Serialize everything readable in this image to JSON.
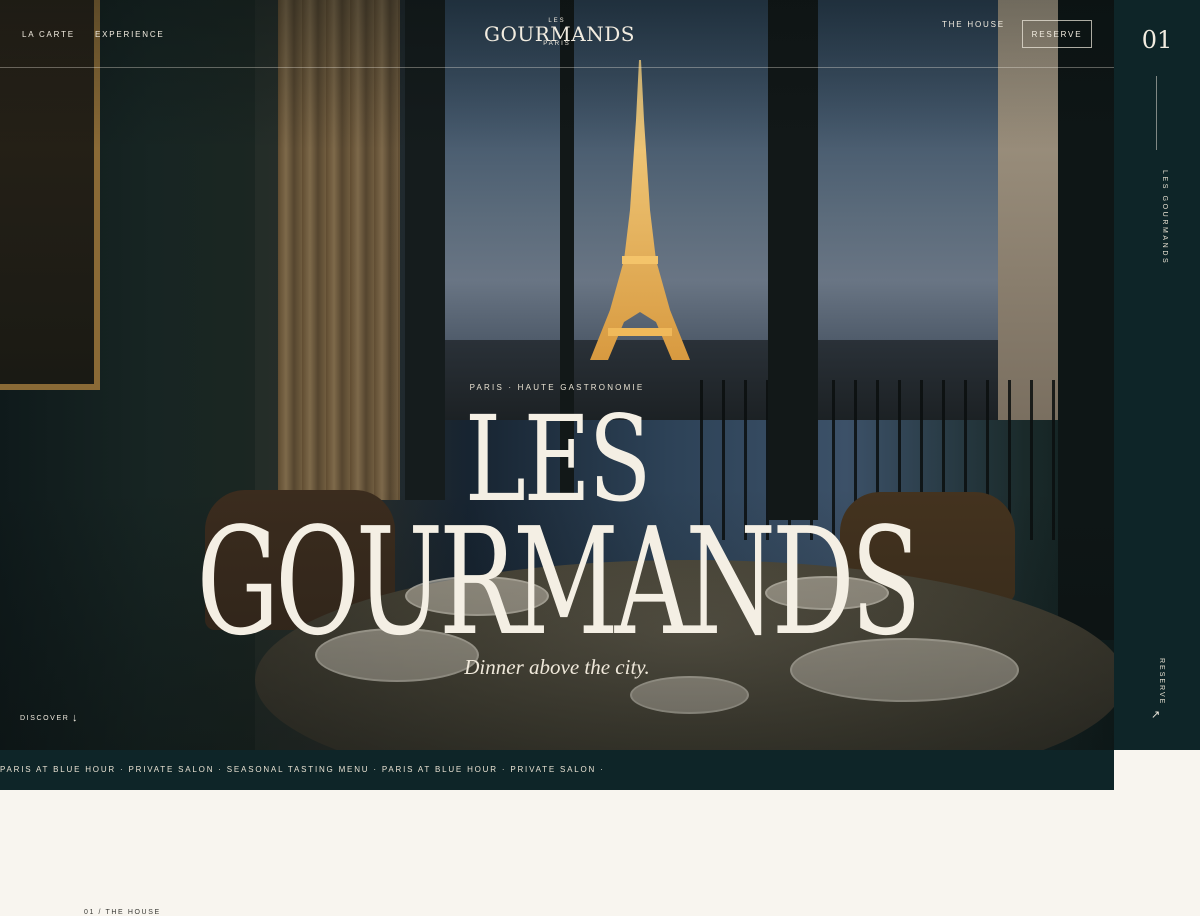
{
  "nav": {
    "left_links": [
      "LA CARTE",
      "EXPERIENCE"
    ],
    "right_link": "THE HOUSE",
    "reserve_label": "RESERVE",
    "logo": {
      "top": "LES",
      "main": "GOURMANDS",
      "bottom": "PARIS"
    }
  },
  "hero": {
    "eyebrow": "PARIS · HAUTE GASTRONOMIE",
    "title_line1": "LES",
    "title_line2": "GOURMANDS",
    "tagline": "Dinner above the city.",
    "discover_label": "DISCOVER",
    "discover_icon": "arrow-down-icon"
  },
  "side_rail": {
    "number": "01",
    "vertical_label": "LES GOURMANDS",
    "reserve_label": "RESERVE",
    "reserve_icon": "arrow-up-right-icon"
  },
  "marquee": {
    "text": "PARIS AT BLUE HOUR · PRIVATE SALON · SEASONAL TASTING MENU · PARIS AT BLUE HOUR · PRIVATE SALON ·"
  },
  "section": {
    "label": "01 / THE HOUSE"
  },
  "colors": {
    "cream": "#f8f5ef",
    "deep_teal": "#0e2528",
    "ivory_text": "#f2ece0"
  }
}
